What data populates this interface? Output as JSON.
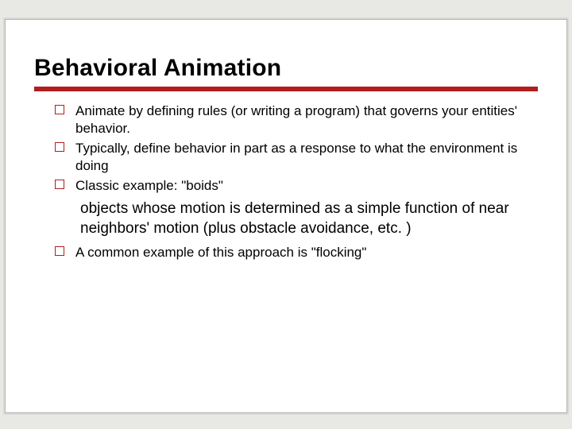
{
  "title": "Behavioral Animation",
  "bullets": {
    "item0": "Animate by defining rules (or writing a program) that governs your entities' behavior.",
    "item1": "Typically, define behavior in part as a response to what the environment is doing",
    "item2": "Classic example: \"boids\"",
    "sub0": "objects whose motion is determined as a simple function of near neighbors' motion (plus obstacle avoidance, etc. )",
    "item3": "A common example of this approach is \"flocking\""
  }
}
